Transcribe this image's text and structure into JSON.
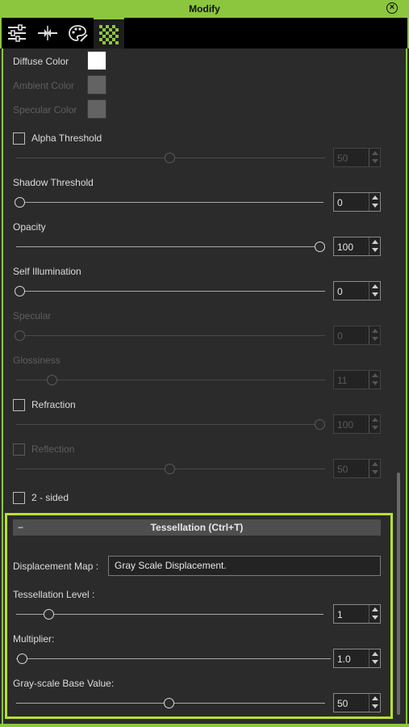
{
  "window": {
    "title": "Modify"
  },
  "tabs": [
    {
      "icon": "sliders-icon"
    },
    {
      "icon": "compress-icon"
    },
    {
      "icon": "palette-icon"
    },
    {
      "icon": "checker-icon"
    }
  ],
  "colors": {
    "diffuse_label": "Diffuse Color",
    "diffuse_value": "#ffffff",
    "ambient_label": "Ambient Color",
    "specular_label": "Specular Color"
  },
  "alpha_threshold": {
    "label": "Alpha Threshold",
    "value": "50",
    "fraction": 0.5
  },
  "shadow_threshold": {
    "label": "Shadow Threshold",
    "value": "0",
    "fraction": 0
  },
  "opacity": {
    "label": "Opacity",
    "value": "100",
    "fraction": 1
  },
  "self_illumination": {
    "label": "Self Illumination",
    "value": "0",
    "fraction": 0
  },
  "specular": {
    "label": "Specular",
    "value": "0",
    "fraction": 0
  },
  "glossiness": {
    "label": "Glossiness",
    "value": "11",
    "fraction": 0.11
  },
  "refraction": {
    "label": "Refraction",
    "value": "100",
    "fraction": 1
  },
  "reflection": {
    "label": "Reflection",
    "value": "50",
    "fraction": 0.5
  },
  "two_sided": {
    "label": "2 - sided"
  },
  "tessellation": {
    "header": "Tessellation  (Ctrl+T)",
    "collapse_symbol": "−",
    "displacement_label": "Displacement Map :",
    "displacement_value": "Gray Scale Displacement.",
    "level_label": "Tessellation Level :",
    "level_value": "1",
    "level_fraction": 0.11,
    "multiplier_label": "Multiplier:",
    "multiplier_value": "1.0",
    "multiplier_fraction": 0.02,
    "base_label": "Gray-scale Base Value:",
    "base_value": "50",
    "base_fraction": 0.5
  }
}
